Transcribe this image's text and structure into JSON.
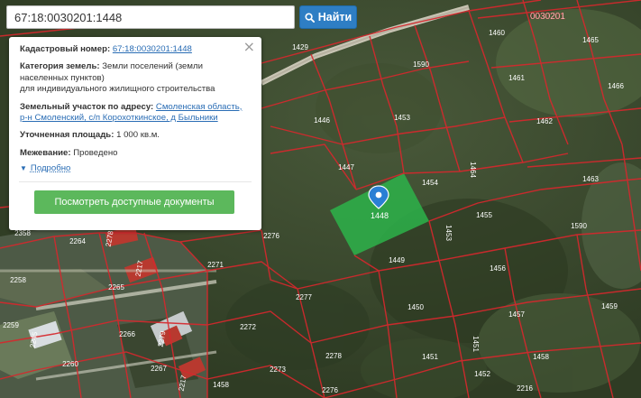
{
  "search": {
    "value": "67:18:0030201:1448",
    "button_label": "Найти"
  },
  "info_panel": {
    "close_symbol": "×",
    "cadastral_label": "Кадастровый номер:",
    "cadastral_value": "67:18:0030201:1448",
    "category_label": "Категория земель:",
    "category_value": "Земли поселений (земли",
    "category_value_2": "населенных пунктов)",
    "category_value_3": "для индивидуального жилищного строительства",
    "address_label": "Земельный участок по адресу:",
    "address_line_1": "Смоленская область,",
    "address_line_2": "р-н Смоленский, с/п Корохоткинское, д Быльники",
    "area_label": "Уточненная площадь:",
    "area_value": "1 000 кв.м.",
    "survey_label": "Межевание:",
    "survey_value": "Проведено",
    "details_link": "Подробно",
    "documents_button": "Посмотреть доступные документы"
  },
  "map": {
    "quarter_label": "0030201",
    "selected_parcel_label": "1448",
    "colors": {
      "parcel_border": "#d6282d",
      "selected_parcel": "#2db34a",
      "marker": "#2a7fd4",
      "quarter_label": "#ffffff"
    },
    "parcel_labels": [
      "1429",
      "1460",
      "1465",
      "1590",
      "1461",
      "1466",
      "1446",
      "1453",
      "1462",
      "1447",
      "1454",
      "1464",
      "1463",
      "1455",
      "1590",
      "2358",
      "2264",
      "2278",
      "2276",
      "1453",
      "2258",
      "2217",
      "2271",
      "1449",
      "1456",
      "2265",
      "2277",
      "1450",
      "1459",
      "2259",
      "2245",
      "2266",
      "2279",
      "2272",
      "1457",
      "2260",
      "2267",
      "2273",
      "2278",
      "1451",
      "1451",
      "1458",
      "1452",
      "2216",
      "2276",
      "1458",
      "2217"
    ]
  }
}
